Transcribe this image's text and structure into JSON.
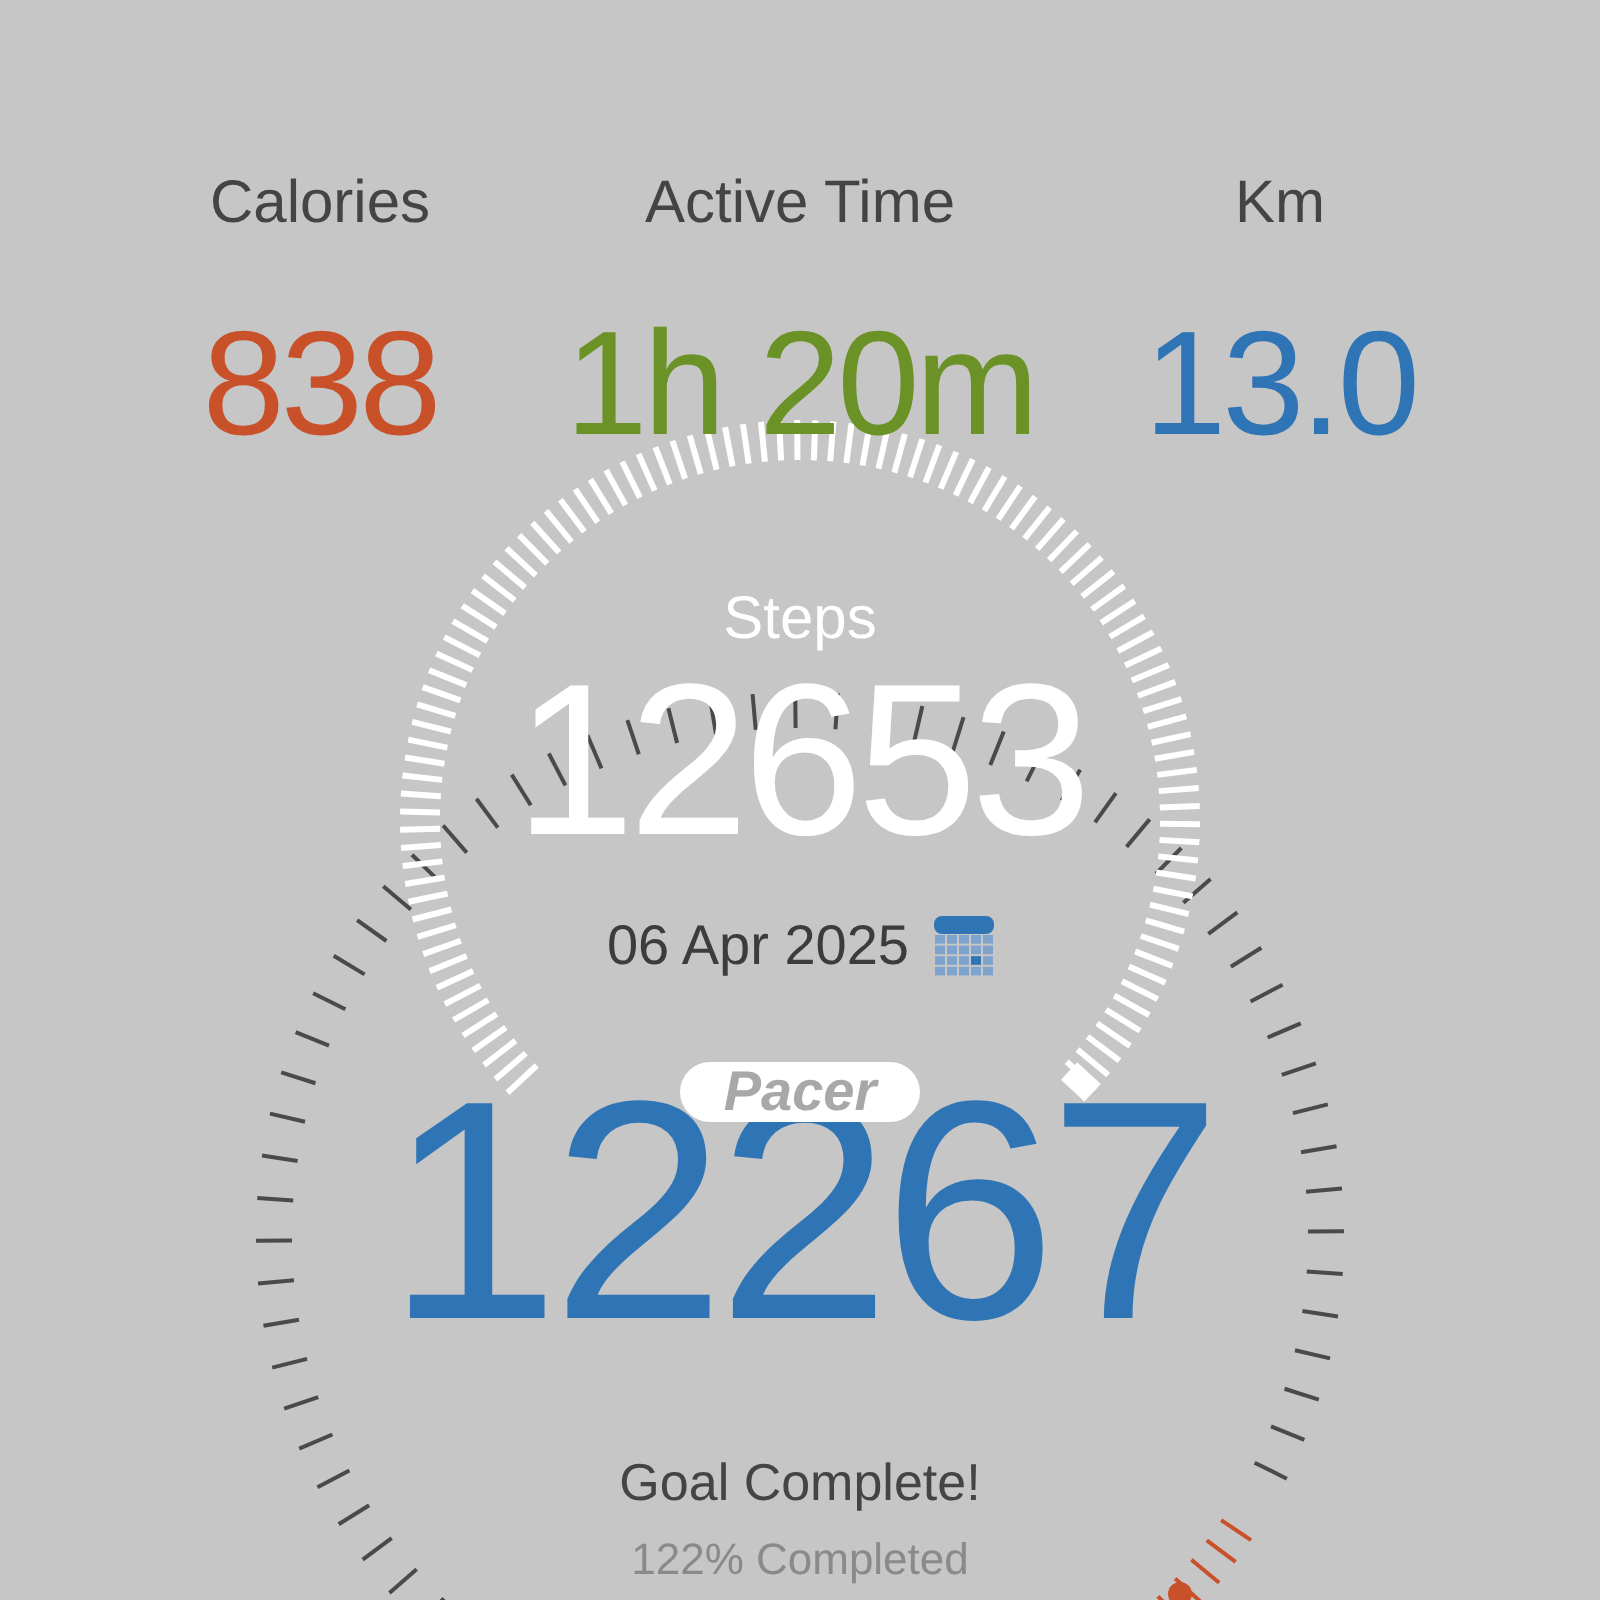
{
  "stats": [
    {
      "label": "Calories",
      "value": "838",
      "color": "#c9512a"
    },
    {
      "label": "Active Time",
      "value": "1h 20m",
      "color": "#6a9226"
    },
    {
      "label": "Km",
      "value": "13.0",
      "color": "#2f75b5"
    }
  ],
  "steps": {
    "label": "Steps",
    "value": "12653",
    "date": "06 Apr 2025"
  },
  "badge": "Pacer",
  "today": {
    "value": "12267",
    "status": "Goal Complete!",
    "progress": "122%  Completed"
  }
}
